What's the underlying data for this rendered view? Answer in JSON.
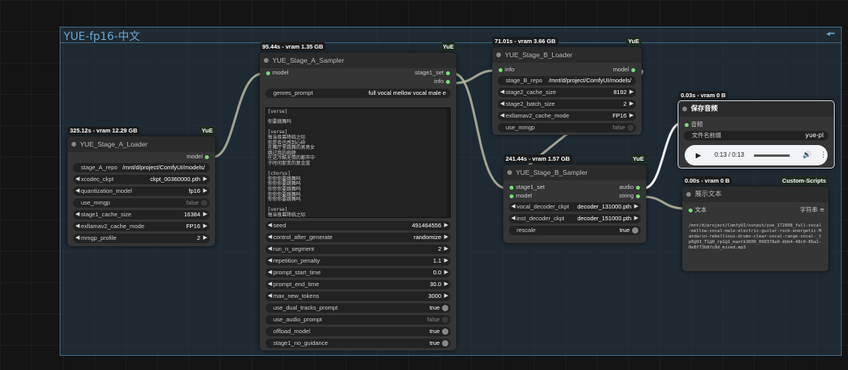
{
  "group": {
    "title": "YUE-fp16-中文"
  },
  "stage_a_loader": {
    "timing": "325.12s - vram 12.29 GB",
    "tag": "YuE",
    "title": "YUE_Stage_A_Loader",
    "output": "model",
    "widgets": [
      {
        "label": "stage_A_repo",
        "value": "/mnt/d/project/ComfyUI/models/",
        "type": "text"
      },
      {
        "label": "xcodec_ckpt",
        "value": "ckpt_00360000.pth",
        "type": "combo"
      },
      {
        "label": "quantization_model",
        "value": "fp16",
        "type": "combo"
      },
      {
        "label": "use_mmgp",
        "value": "false",
        "type": "toggle"
      },
      {
        "label": "stage1_cache_size",
        "value": "16384",
        "type": "combo"
      },
      {
        "label": "exllamav2_cache_mode",
        "value": "FP16",
        "type": "combo"
      },
      {
        "label": "mmgp_profile",
        "value": "2",
        "type": "combo"
      }
    ]
  },
  "stage_a_sampler": {
    "timing": "95.44s - vram 1.35 GB",
    "tag": "YuE",
    "title": "YUE_Stage_A_Sampler",
    "input": "model",
    "outputs": [
      "stage1_set",
      "info"
    ],
    "genres_label": "genres_prompt",
    "genres_value": "full vocal mellow vocal male e",
    "lyrics": [
      "[verse]",
      "",
      "你要跳舞吗",
      "",
      "[verse]",
      "每当夜幕降临之际",
      "你是否也感到心碎",
      "在舞厅里跳舞的男男女",
      "跳过我的肩膀",
      "在这冷酷无情的都市中",
      "于时间那变的复金蓝",
      "",
      "[chorus]",
      "你你你要跳舞吗",
      "你你你要跳舞吗",
      "你你你要跳舞吗",
      "你你你要跳舞吗",
      "你你你要跳舞吗",
      "",
      "[verse]",
      "每当夜幕降临之际"
    ],
    "widgets": [
      {
        "label": "seed",
        "value": "491464556",
        "type": "combo"
      },
      {
        "label": "control_after_generate",
        "value": "randomize",
        "type": "combo"
      },
      {
        "label": "run_n_segment",
        "value": "2",
        "type": "combo"
      },
      {
        "label": "repetition_penalty",
        "value": "1.1",
        "type": "combo"
      },
      {
        "label": "prompt_start_time",
        "value": "0.0",
        "type": "combo"
      },
      {
        "label": "prompt_end_time",
        "value": "30.0",
        "type": "combo"
      },
      {
        "label": "max_new_tokens",
        "value": "3000",
        "type": "combo"
      },
      {
        "label": "use_dual_tracks_prompt",
        "value": "true",
        "type": "toggle"
      },
      {
        "label": "use_audio_prompt",
        "value": "false",
        "type": "toggle"
      },
      {
        "label": "offload_model",
        "value": "true",
        "type": "toggle"
      },
      {
        "label": "stage1_no_guidance",
        "value": "true",
        "type": "toggle"
      }
    ]
  },
  "stage_b_loader": {
    "timing": "71.01s - vram 3.66 GB",
    "tag": "YuE",
    "title": "YUE_Stage_B_Loader",
    "input": "info",
    "output": "model",
    "widgets": [
      {
        "label": "stage_B_repo",
        "value": "/mnt/d/project/ComfyUI/models/",
        "type": "text"
      },
      {
        "label": "stage2_cache_size",
        "value": "8192",
        "type": "combo"
      },
      {
        "label": "stage2_batch_size",
        "value": "2",
        "type": "combo"
      },
      {
        "label": "exllamav2_cache_mode",
        "value": "FP16",
        "type": "combo"
      },
      {
        "label": "use_mmgp",
        "value": "false",
        "type": "toggle"
      }
    ]
  },
  "stage_b_sampler": {
    "timing": "241.44s - vram 1.57 GB",
    "tag": "YuE",
    "title": "YUE_Stage_B_Sampler",
    "inputs": [
      "stage1_set",
      "model"
    ],
    "outputs": [
      "audio",
      "string"
    ],
    "widgets": [
      {
        "label": "vocal_decoder_ckpt",
        "value": "decoder_131000.pth",
        "type": "combo"
      },
      {
        "label": "inst_decoder_ckpt",
        "value": "decoder_151000.pth",
        "type": "combo"
      },
      {
        "label": "rescale",
        "value": "true",
        "type": "toggle"
      }
    ]
  },
  "save_audio": {
    "timing": "0.03s - vram 0 B",
    "title": "保存音频",
    "input": "音频",
    "prefix_label": "文件名前缀",
    "prefix_value": "yue-pl",
    "time": "0:13 / 0:13"
  },
  "show_text": {
    "timing": "0.00s - vram 0 B",
    "tag": "Custom-Scripts",
    "title": "展示文本",
    "input": "文本",
    "input_type": "字符串",
    "text": "/mnt/d/project/ComfyUI/output/yue_172808_full-vocal-mellow-vocal-male-electric-guitar-rock-energetic-Mandarin-rebellious-drums-clear-vocal-range-vocal-_tp0@93_T1@0_rp1@1_maxtk3000_060378a0-dbb4-48c9-86a1-0e8f73b8fc8d_mixed.mp3"
  }
}
